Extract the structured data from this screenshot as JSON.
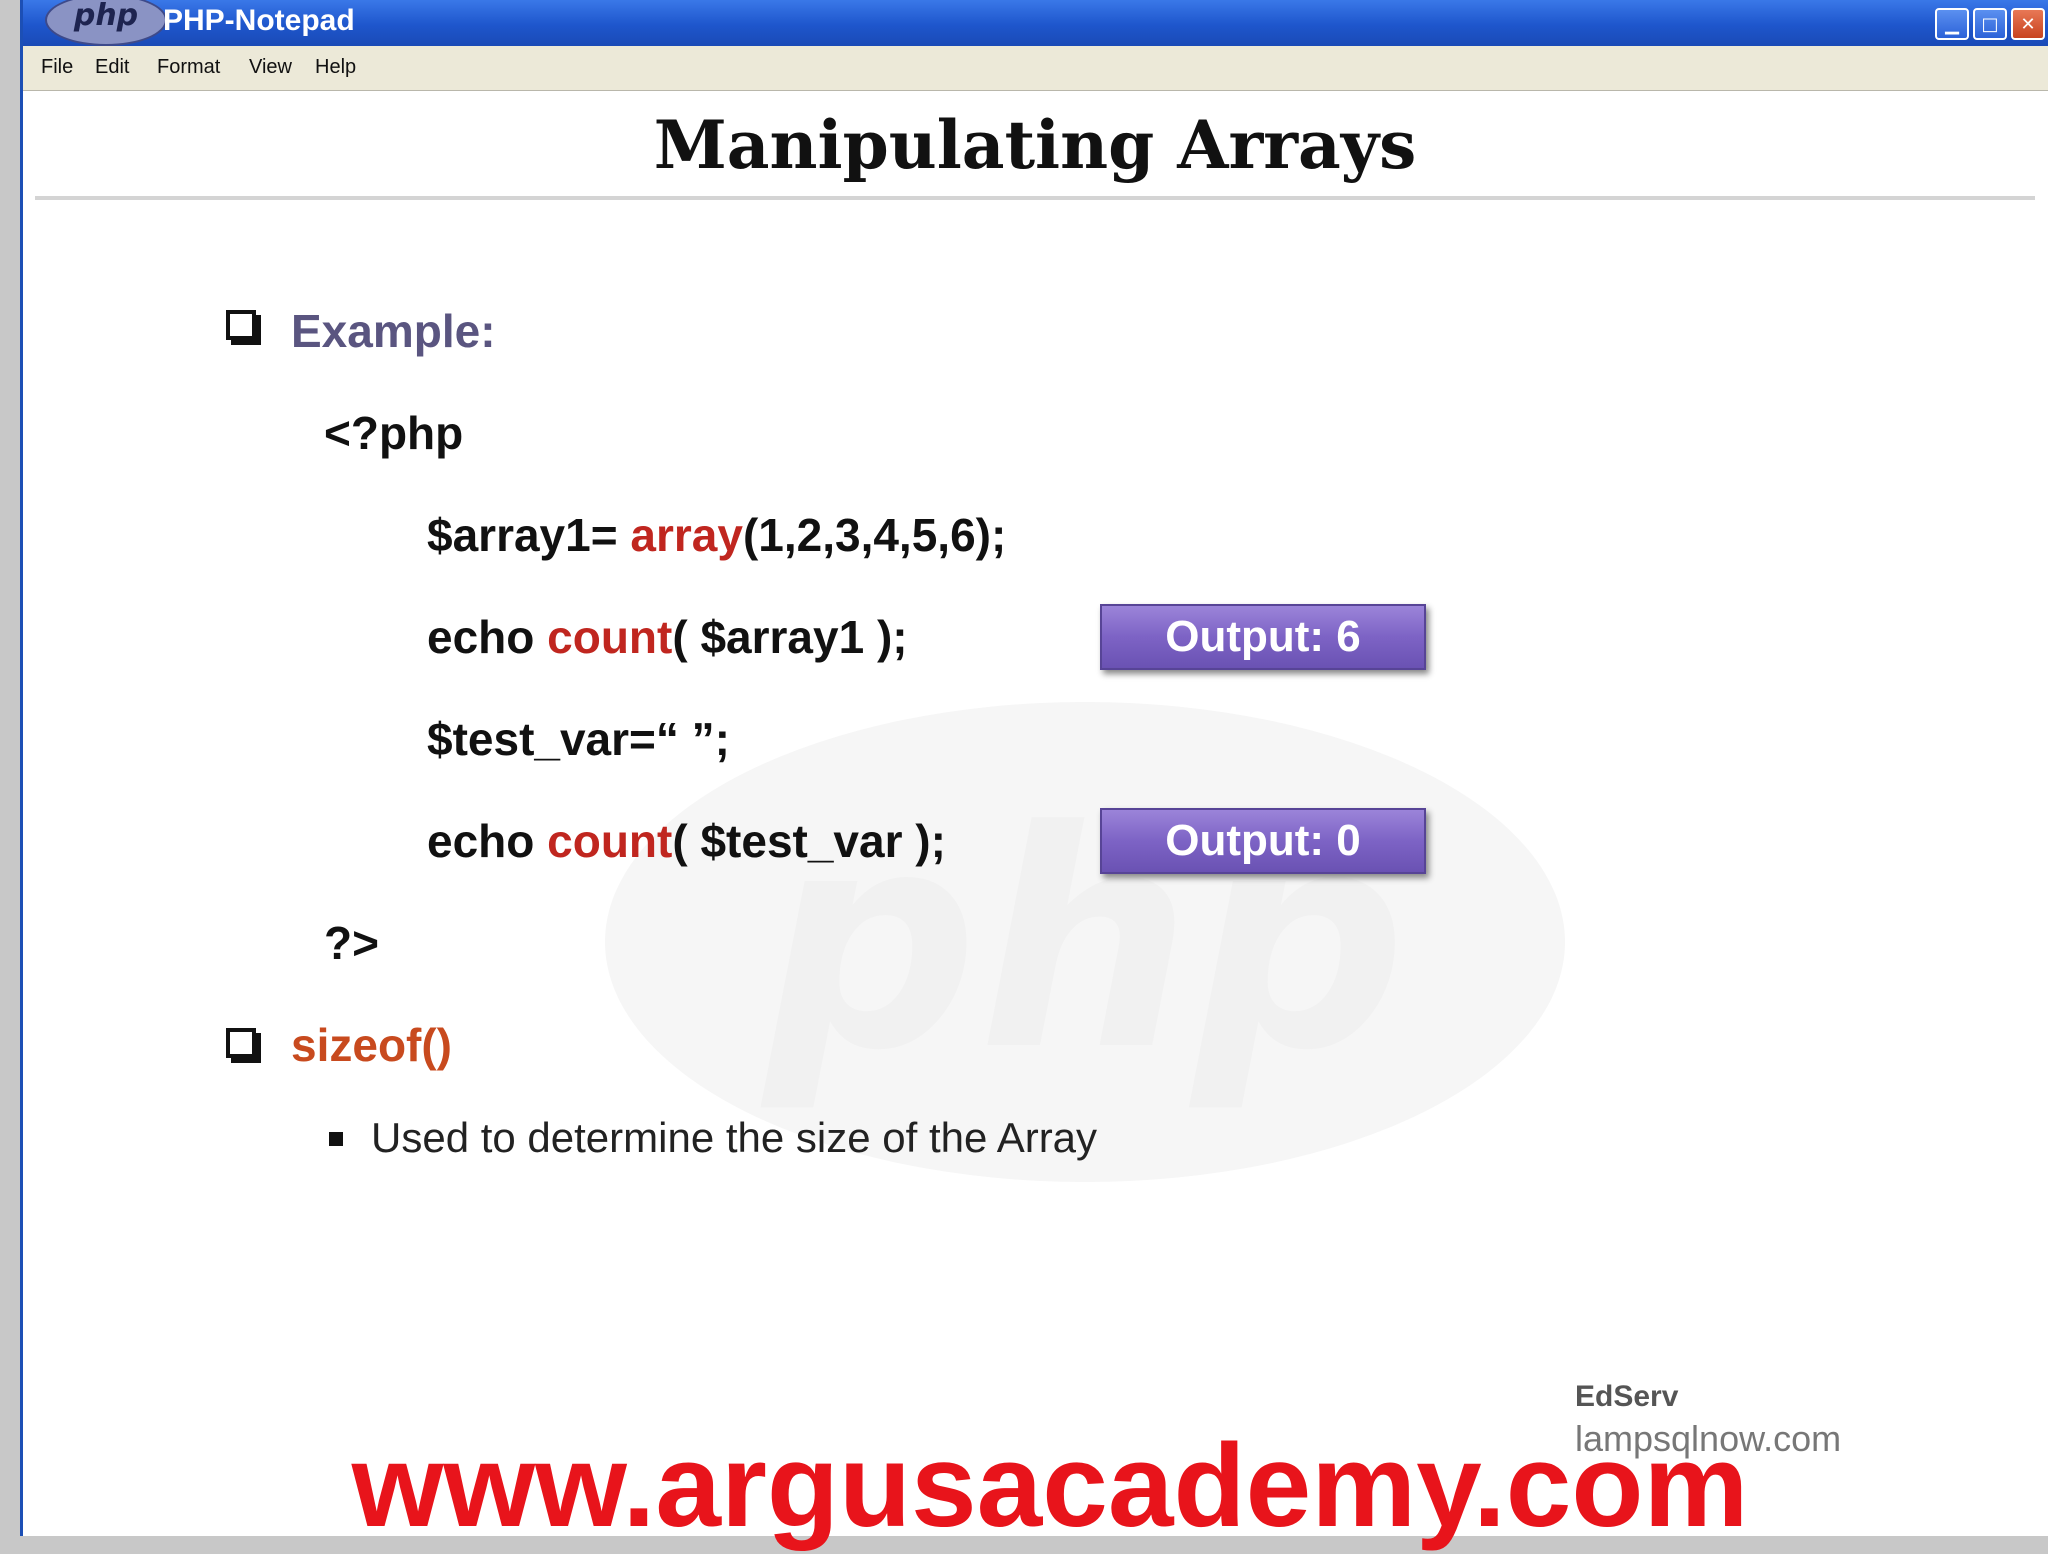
{
  "window": {
    "title": "PHP-Notepad",
    "logo_text": "php",
    "controls": {
      "minimize": "▁",
      "maximize": "□",
      "close": "✕"
    }
  },
  "menu": [
    "File",
    "Edit",
    "Format",
    "View",
    "Help"
  ],
  "slide": {
    "title": "Manipulating Arrays",
    "example_label": "Example:",
    "code": {
      "open_tag": "<?php",
      "line1_a": "$array1= ",
      "line1_fn": "array",
      "line1_b": "(1,2,3,4,5,6);",
      "line2_a": "echo ",
      "line2_fn": "count",
      "line2_b": "( $array1 );",
      "line3": "$test_var=“ ”;",
      "line4_a": "echo ",
      "line4_fn": "count",
      "line4_b": "( $test_var );",
      "close_tag": "?>"
    },
    "outputs": [
      "Output: 6",
      "Output: 0"
    ],
    "sizeof_label": "sizeof()",
    "sizeof_desc": "Used to determine the size of the Array",
    "watermark": "php",
    "brand": {
      "edserv": "EdServ",
      "site": "lampsqlnow.com"
    }
  },
  "banner": "www.argusacademy.com",
  "colors": {
    "titlebar": "#1e56cc",
    "keyword_red": "#c0261f",
    "heading_purple": "#5a5580",
    "sizeof_orange": "#c84a1e",
    "output_button": "#7d63c5",
    "banner_red": "#e8141b"
  }
}
